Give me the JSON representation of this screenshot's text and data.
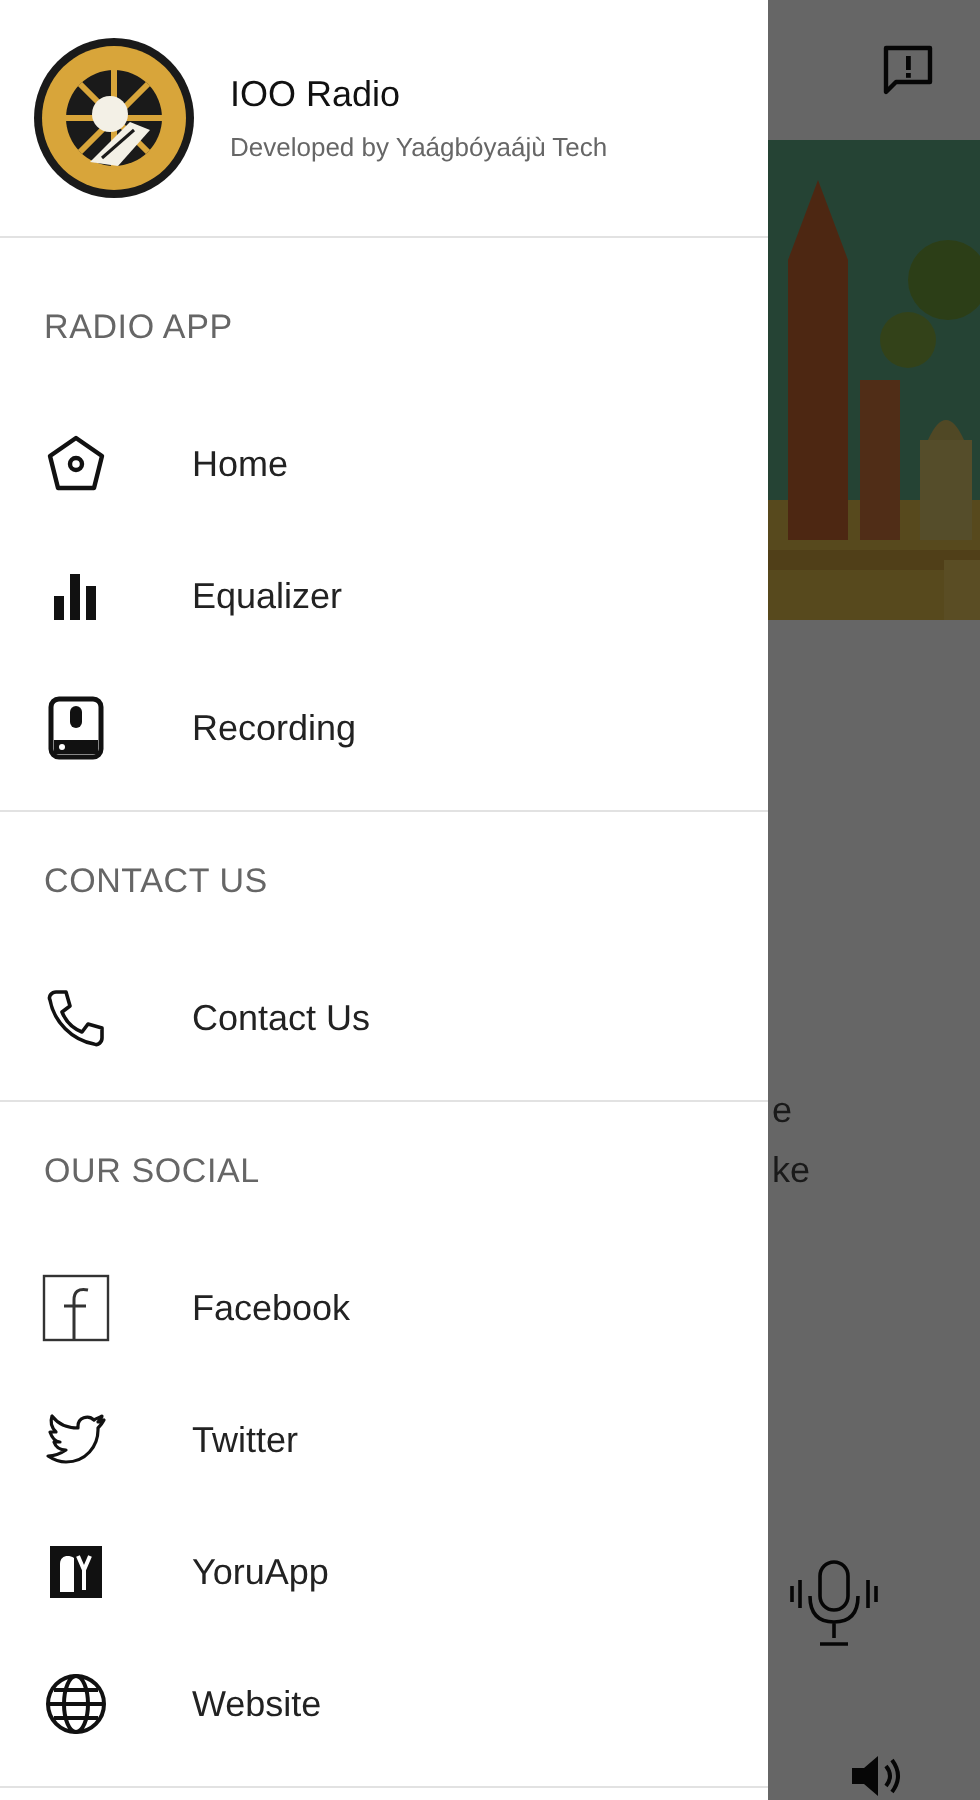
{
  "drawer": {
    "header": {
      "title": "IOO Radio",
      "subtitle": "Developed by Yaágbóyaájù Tech"
    },
    "sections": [
      {
        "title": "RADIO APP",
        "items": [
          {
            "label": "Home",
            "kind": "home"
          },
          {
            "label": "Equalizer",
            "kind": "equalizer"
          },
          {
            "label": "Recording",
            "kind": "recording"
          }
        ]
      },
      {
        "title": "CONTACT US",
        "items": [
          {
            "label": "Contact Us",
            "kind": "phone"
          }
        ]
      },
      {
        "title": "OUR SOCIAL",
        "items": [
          {
            "label": "Facebook",
            "kind": "facebook"
          },
          {
            "label": "Twitter",
            "kind": "bird"
          },
          {
            "label": "YoruApp",
            "kind": "yoru"
          },
          {
            "label": "Website",
            "kind": "globe"
          }
        ]
      }
    ]
  },
  "background": {
    "text_lines": [
      "e",
      "ke"
    ]
  }
}
